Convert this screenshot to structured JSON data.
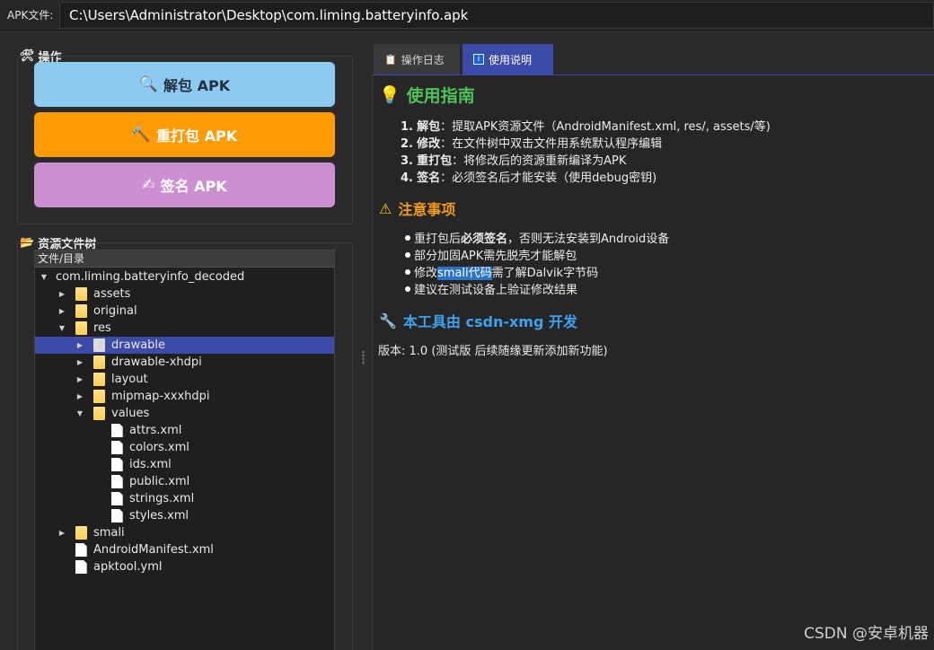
{
  "apk_bar": {
    "label": "APK文件:",
    "path": "C:\\Users\\Administrator\\Desktop\\com.liming.batteryinfo.apk"
  },
  "operations": {
    "title": "操作",
    "title_icon": "tools-icon",
    "buttons": [
      {
        "label": "解包 APK",
        "icon": "magnifier-icon",
        "color": "#8ec9f2"
      },
      {
        "label": "重打包 APK",
        "icon": "hammer-icon",
        "color": "#ff9b07"
      },
      {
        "label": "签名 APK",
        "icon": "signature-icon",
        "color": "#cc8fd2"
      }
    ]
  },
  "resource_tree": {
    "title": "资源文件树",
    "title_icon": "folder-icon",
    "column_header": "文件/目录",
    "rows": [
      {
        "label": "com.liming.batteryinfo_decoded",
        "kind": "root",
        "depth": 0,
        "expanded": true
      },
      {
        "label": "assets",
        "kind": "folder",
        "depth": 1,
        "expanded": false
      },
      {
        "label": "original",
        "kind": "folder",
        "depth": 1,
        "expanded": false
      },
      {
        "label": "res",
        "kind": "folder",
        "depth": 1,
        "expanded": true
      },
      {
        "label": "drawable",
        "kind": "folder",
        "depth": 2,
        "expanded": false,
        "selected": true
      },
      {
        "label": "drawable-xhdpi",
        "kind": "folder",
        "depth": 2,
        "expanded": false
      },
      {
        "label": "layout",
        "kind": "folder",
        "depth": 2,
        "expanded": false
      },
      {
        "label": "mipmap-xxxhdpi",
        "kind": "folder",
        "depth": 2,
        "expanded": false
      },
      {
        "label": "values",
        "kind": "folder",
        "depth": 2,
        "expanded": true
      },
      {
        "label": "attrs.xml",
        "kind": "file",
        "depth": 3
      },
      {
        "label": "colors.xml",
        "kind": "file",
        "depth": 3
      },
      {
        "label": "ids.xml",
        "kind": "file",
        "depth": 3
      },
      {
        "label": "public.xml",
        "kind": "file",
        "depth": 3
      },
      {
        "label": "strings.xml",
        "kind": "file",
        "depth": 3
      },
      {
        "label": "styles.xml",
        "kind": "file",
        "depth": 3
      },
      {
        "label": "smali",
        "kind": "folder",
        "depth": 1,
        "expanded": false
      },
      {
        "label": "AndroidManifest.xml",
        "kind": "file",
        "depth": 1
      },
      {
        "label": "apktool.yml",
        "kind": "file",
        "depth": 1
      }
    ]
  },
  "tabs": [
    {
      "label": "操作日志",
      "icon": "clipboard-icon",
      "active": false
    },
    {
      "label": "使用说明",
      "icon": "info-icon",
      "active": true
    }
  ],
  "guide": {
    "title": "使用指南",
    "title_icon": "lightbulb-icon",
    "steps": [
      {
        "num": "1.",
        "name": "解包",
        "desc": "：提取APK资源文件（AndroidManifest.xml, res/, assets/等)"
      },
      {
        "num": "2.",
        "name": "修改",
        "desc": "：在文件树中双击文件用系统默认程序编辑"
      },
      {
        "num": "3.",
        "name": "重打包",
        "desc": "：将修改后的资源重新编译为APK"
      },
      {
        "num": "4.",
        "name": "签名",
        "desc": "：必须签名后才能安装（使用debug密钥)"
      }
    ],
    "notes_title": "注意事项",
    "notes_icon": "warning-icon",
    "notes": [
      {
        "pre": "重打包后",
        "bold": "必须签名",
        "post": "，否则无法安装到Android设备"
      },
      {
        "pre": "部分加固APK需先脱壳才能解包",
        "bold": "",
        "post": ""
      },
      {
        "pre": "修改",
        "highlight": "smali代码",
        "post": "需了解Dalvik字节码"
      },
      {
        "pre": "建议在测试设备上验证修改结果",
        "bold": "",
        "post": ""
      }
    ],
    "author_line": "本工具由 csdn-xmg 开发",
    "author_icon": "wrench-icon",
    "version": "版本: 1.0 (测试版 后续随缘更新添加新功能)"
  },
  "watermark": "CSDN @安卓机器",
  "colors": {
    "background": "#2b2b2b",
    "selection": "#3d4ba8",
    "accent_green": "#4ec25a",
    "accent_orange": "#f39a1a",
    "accent_blue": "#3da2f0"
  }
}
